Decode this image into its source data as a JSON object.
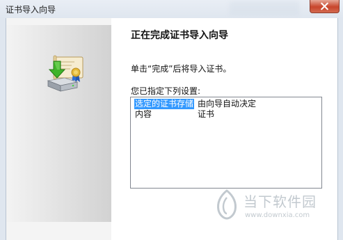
{
  "window": {
    "title": "证书导入向导"
  },
  "wizard": {
    "heading": "正在完成证书导入向导",
    "instruction": "单击“完成”后将导入证书。",
    "settings_label": "您已指定下列设置:",
    "settings": [
      {
        "name": "选定的证书存储",
        "value": "由向导自动决定",
        "selected": true
      },
      {
        "name": "内容",
        "value": "证书",
        "selected": false
      }
    ]
  },
  "icons": {
    "sidebar": "certificate-import-icon",
    "close": "close-icon"
  },
  "colors": {
    "selection": "#3399ff",
    "close_button": "#c8452c"
  },
  "watermark": {
    "title": "当下软件园",
    "url": "www.downxia.com"
  }
}
